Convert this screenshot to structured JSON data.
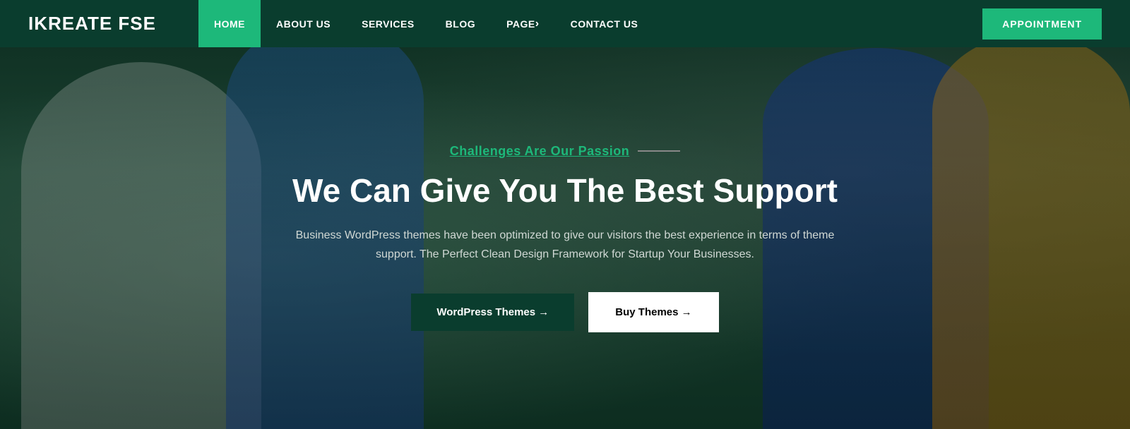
{
  "brand": {
    "logo": "IKREATE FSE"
  },
  "nav": {
    "items": [
      {
        "label": "HOME",
        "active": true,
        "hasArrow": false
      },
      {
        "label": "ABOUT US",
        "active": false,
        "hasArrow": false
      },
      {
        "label": "SERVICES",
        "active": false,
        "hasArrow": false
      },
      {
        "label": "BLOG",
        "active": false,
        "hasArrow": false
      },
      {
        "label": "PAGE",
        "active": false,
        "hasArrow": true
      },
      {
        "label": "CONTACT US",
        "active": false,
        "hasArrow": false
      }
    ],
    "appointment_label": "APPOINTMENT"
  },
  "hero": {
    "tagline": "Challenges Are Our Passion",
    "title": "We Can Give You The Best Support",
    "description": "Business WordPress themes have been optimized to give our visitors the best experience in terms of theme support. The Perfect Clean Design Framework for Startup Your Businesses.",
    "btn_primary": "WordPress Themes →",
    "btn_secondary": "Buy Themes →"
  }
}
